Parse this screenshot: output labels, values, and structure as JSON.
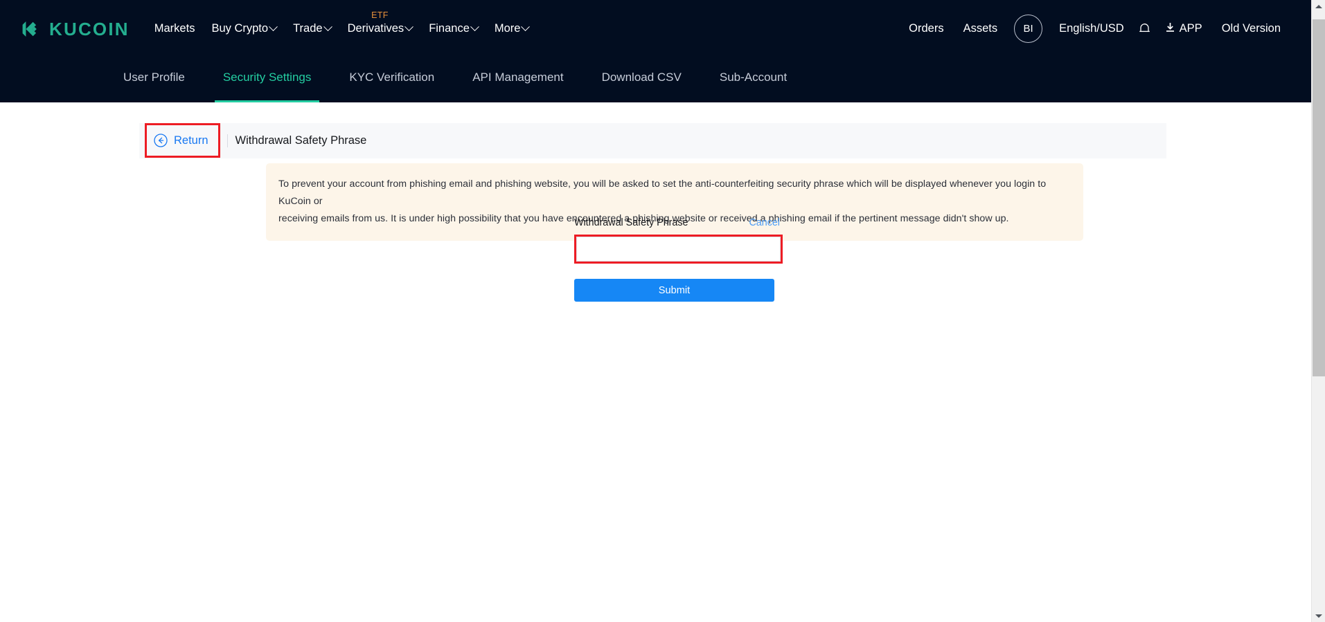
{
  "brand": {
    "name": "KUCOIN",
    "logo_color": "#24ae8f",
    "header_bg": "#020d20"
  },
  "header": {
    "nav": [
      {
        "label": "Markets",
        "caret": false,
        "badge": null
      },
      {
        "label": "Buy Crypto",
        "caret": true,
        "badge": null
      },
      {
        "label": "Trade",
        "caret": true,
        "badge": null
      },
      {
        "label": "Derivatives",
        "caret": true,
        "badge": "ETF"
      },
      {
        "label": "Finance",
        "caret": true,
        "badge": null
      },
      {
        "label": "More",
        "caret": true,
        "badge": null
      }
    ],
    "right": {
      "orders": "Orders",
      "assets": "Assets",
      "avatar_initials": "BI",
      "language": "English/USD",
      "notification_icon": "bell-icon",
      "app": "APP",
      "download_icon": "download-icon",
      "old_version": "Old Version"
    }
  },
  "subnav": {
    "items": [
      {
        "label": "User Profile",
        "active": false
      },
      {
        "label": "Security Settings",
        "active": true
      },
      {
        "label": "KYC Verification",
        "active": false
      },
      {
        "label": "API Management",
        "active": false
      },
      {
        "label": "Download CSV",
        "active": false
      },
      {
        "label": "Sub-Account",
        "active": false
      }
    ],
    "active_color": "#24cda1"
  },
  "page_head": {
    "return_label": "Return",
    "return_icon": "circle-arrow-left-icon",
    "title": "Withdrawal Safety Phrase",
    "highlight_color": "#ed1c24"
  },
  "notice": {
    "line1": "To prevent your account from phishing email and phishing website, you will be asked to set the anti-counterfeiting security phrase which will be displayed whenever you login to KuCoin or",
    "line2": "receiving emails from us. It is under high possibility that you have encountered a phishing website or received a phishing email if the pertinent message didn't show up.",
    "bg": "#fdf5e9"
  },
  "form": {
    "field_label": "Withdrawal Safety Phrase",
    "cancel_label": "Cancel",
    "input_value": "",
    "input_placeholder": "",
    "submit_label": "Submit",
    "submit_color": "#1687f5"
  },
  "scrollbar": {
    "up_arrow": "scroll-up-arrow",
    "down_arrow": "scroll-down-arrow"
  }
}
